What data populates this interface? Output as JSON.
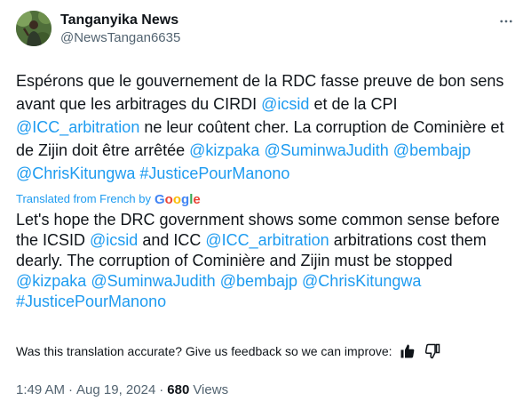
{
  "author": {
    "display_name": "Tanganyika News",
    "handle": "@NewsTangan6635"
  },
  "tweet": {
    "original": {
      "t1": "Espérons que le gouvernement de la RDC fasse preuve de bon sens avant que les arbitrages du CIRDI ",
      "m1": "@icsid",
      "t2": " et de la CPI ",
      "m2": "@ICC_arbitration",
      "t3": " ne leur coûtent cher. La corruption de Cominière et de Zijin doit être arrêtée ",
      "m3": "@kizpaka",
      "m4": "@SuminwaJudith",
      "m5": "@bembajp",
      "m6": "@ChrisKitungwa",
      "h1": "#JusticePourManono"
    },
    "translated_label": "Translated from French by",
    "translator": "Google",
    "translation": {
      "t1": "Let's hope the DRC government shows some common sense before the ICSID ",
      "m1": "@icsid",
      "t2": " and ICC ",
      "m2": "@ICC_arbitration",
      "t3": " arbitrations cost them dearly. The corruption of Cominière and Zijin must be stopped ",
      "m3": "@kizpaka",
      "m4": "@SuminwaJudith",
      "m5": "@bembajp",
      "m6": "@ChrisKitungwa",
      "h1": "#JusticePourManono"
    },
    "feedback_prompt": "Was this translation accurate? Give us feedback so we can improve:",
    "time": "1:49 AM",
    "date": "Aug 19, 2024",
    "views_count": "680",
    "views_label": "Views"
  },
  "icons": {
    "more": "more-horizontal-icon",
    "thumbs_up": "thumbs-up-icon",
    "thumbs_down": "thumbs-down-icon",
    "google": "google-logo"
  },
  "colors": {
    "link": "#1d9bf0",
    "text": "#0f1419",
    "secondary": "#536471"
  }
}
